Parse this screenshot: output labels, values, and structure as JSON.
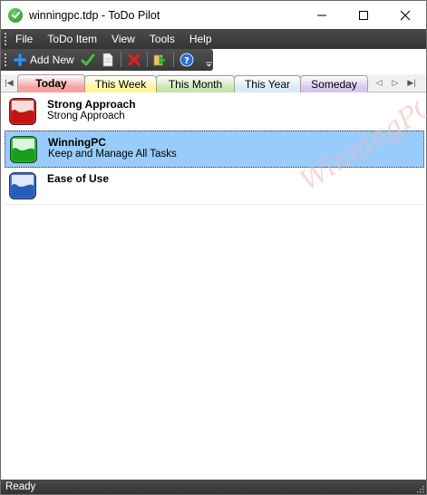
{
  "window": {
    "title": "winningpc.tdp - ToDo Pilot"
  },
  "menu": {
    "items": [
      "File",
      "ToDo Item",
      "View",
      "Tools",
      "Help"
    ]
  },
  "toolbar": {
    "add_new_label": "Add New"
  },
  "tabs": [
    {
      "label": "Today",
      "color": "#f4a3a3",
      "active": true
    },
    {
      "label": "This Week",
      "color": "#fff59a",
      "active": false
    },
    {
      "label": "This Month",
      "color": "#c8e6b0",
      "active": false
    },
    {
      "label": "This Year",
      "color": "#dbe9f7",
      "active": false
    },
    {
      "label": "Someday",
      "color": "#d9c6ef",
      "active": false
    }
  ],
  "tasks": [
    {
      "title": "Strong Approach",
      "description": "Strong Approach",
      "priority_color": "#e01818",
      "priority_icon": "red-priority-icon",
      "selected": false
    },
    {
      "title": "WinningPC",
      "description": "Keep and Manage All Tasks",
      "priority_color": "#1fb51f",
      "priority_icon": "green-priority-icon",
      "selected": true
    },
    {
      "title": "Ease of Use",
      "description": "",
      "priority_color": "#2f6ad6",
      "priority_icon": "blue-priority-icon",
      "selected": false
    }
  ],
  "watermark": {
    "text": "WinningPC"
  },
  "status": {
    "text": "Ready"
  },
  "colors": {
    "selection": "#99ccfa",
    "menubar": "#3f3f3f"
  }
}
